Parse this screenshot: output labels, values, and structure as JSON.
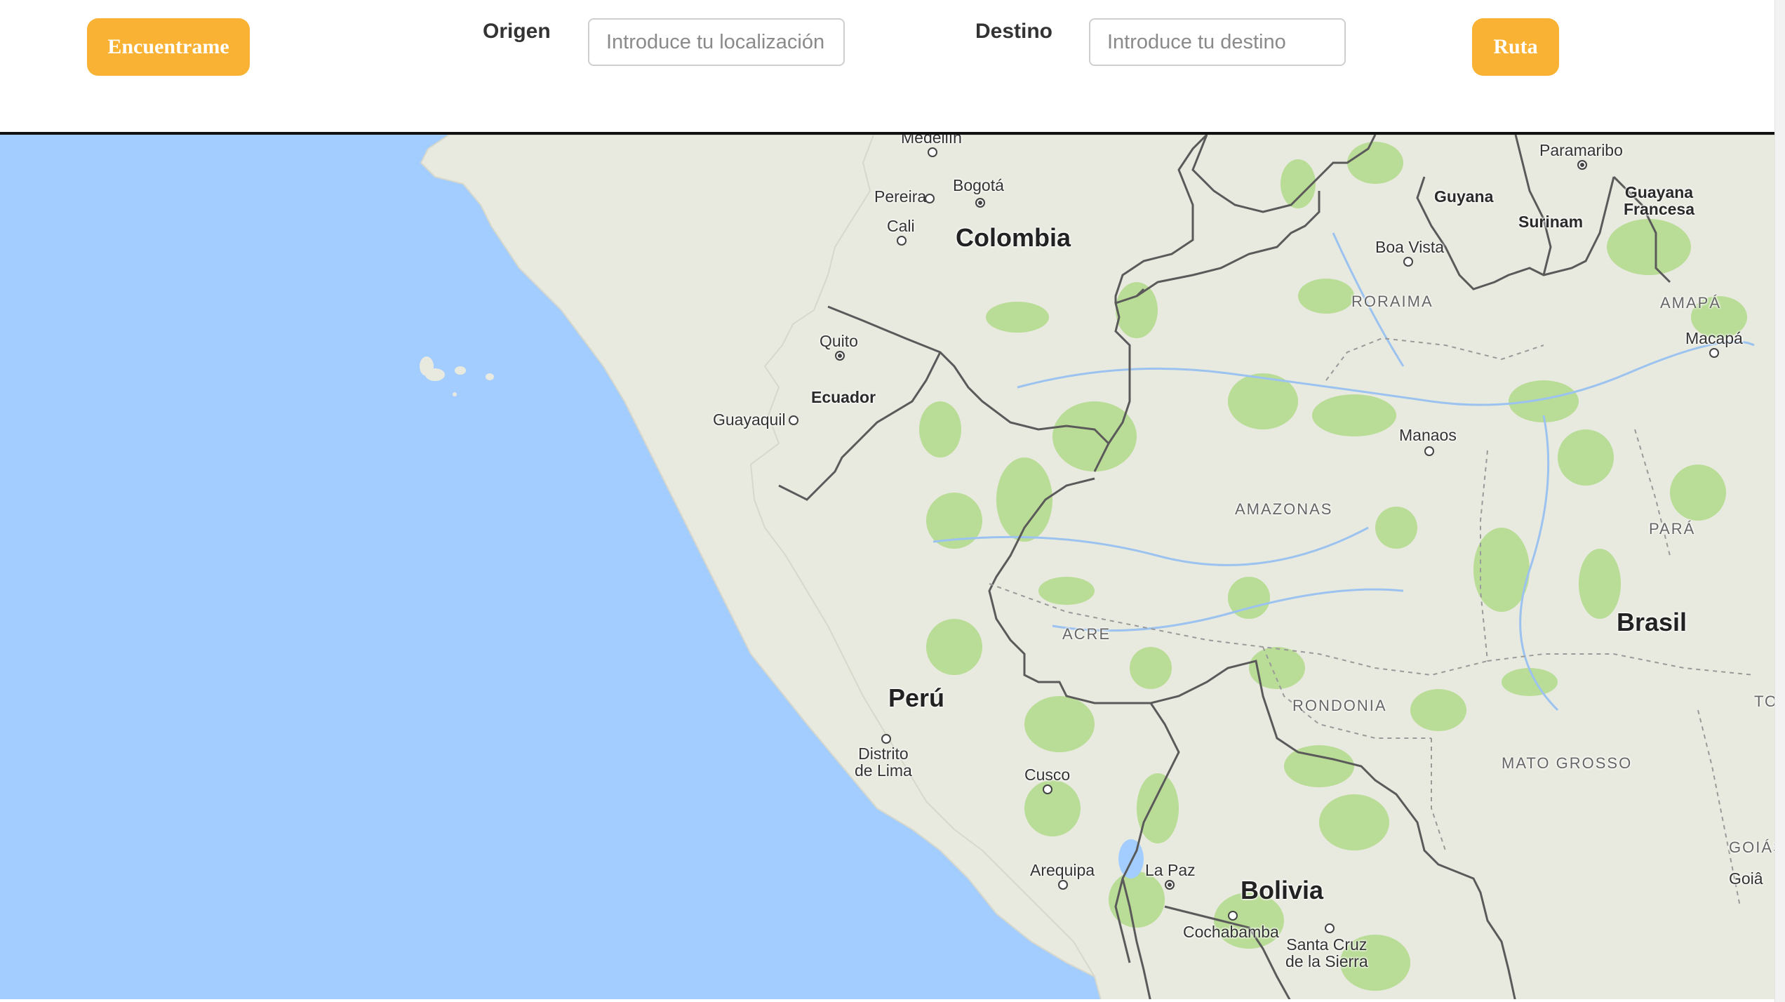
{
  "header": {
    "find_button_label": "Encuentrame",
    "origin_label": "Origen",
    "origin_input": {
      "placeholder": "Introduce tu localización",
      "value": ""
    },
    "destination_label": "Destino",
    "destination_input": {
      "placeholder": "Introduce tu destino",
      "value": ""
    },
    "route_button_label": "Ruta"
  },
  "colors": {
    "button_bg": "#f9b233",
    "ocean": "#a3ccff",
    "land": "#e8eadf",
    "forest": "#b9dc96",
    "border": "#5a5a5a"
  },
  "map": {
    "countries": {
      "colombia": "Colombia",
      "ecuador": "Ecuador",
      "peru": "Perú",
      "brasil": "Brasil",
      "bolivia": "Bolivia",
      "guyana": "Guyana",
      "surinam": "Surinam",
      "guayana_francesa": "Guayana\nFrancesa"
    },
    "cities": {
      "medellin": "Medellín",
      "pereira": "Pereira",
      "bogota": "Bogotá",
      "cali": "Cali",
      "quito": "Quito",
      "guayaquil": "Guayaquil",
      "paramaribo": "Paramaribo",
      "boa_vista": "Boa Vista",
      "macapa": "Macapá",
      "manaos": "Manaos",
      "lima": "Distrito\nde Lima",
      "cusco": "Cusco",
      "arequipa": "Arequipa",
      "la_paz": "La Paz",
      "cochabamba": "Cochabamba",
      "santa_cruz": "Santa Cruz\nde la Sierra",
      "goia": "Goiâ"
    },
    "regions": {
      "roraima": "RORAIMA",
      "amapa": "AMAPÁ",
      "amazonas": "AMAZONAS",
      "para": "PARÁ",
      "acre": "ACRE",
      "rondonia": "RONDONIA",
      "mato_grosso": "MATO GROSSO",
      "goias": "GOIÁS",
      "to": "TO"
    }
  }
}
